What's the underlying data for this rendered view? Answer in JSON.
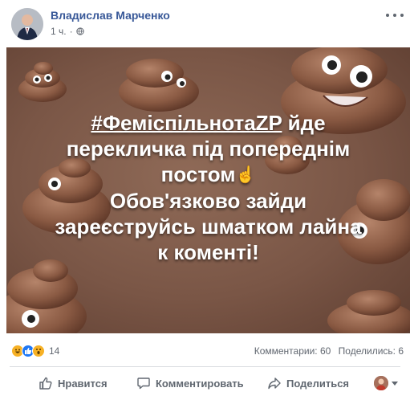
{
  "post": {
    "author": "Владислав Марченко",
    "time": "1 ч.",
    "separator": "·",
    "image_text": {
      "hashtag": "#ФеміспільнотаZP",
      "line1_rest": " йде",
      "line2": "перекличка під попереднім",
      "line3": "постом",
      "line3_emoji": "☝",
      "line4": "Обов'язково зайди",
      "line5": "зареєструйсь шматком лайна",
      "line6": "к коменті!"
    }
  },
  "reactions": {
    "icons": [
      "haha-icon",
      "like-icon",
      "wow-icon"
    ],
    "count": "14"
  },
  "stats": {
    "comments": "Комментарии: 60",
    "shares": "Поделились: 6"
  },
  "actions": {
    "like": "Нравится",
    "comment": "Комментировать",
    "share": "Поделиться"
  },
  "colors": {
    "author_link": "#385898",
    "image_background": "#7a5646",
    "like_blue": "#2078f4"
  }
}
